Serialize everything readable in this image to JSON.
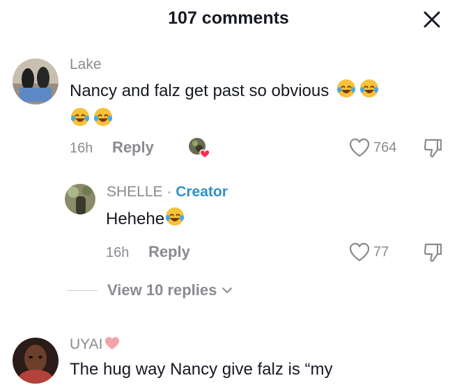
{
  "header": {
    "title": "107 comments"
  },
  "comments": [
    {
      "username": "Lake",
      "text_line1": "Nancy and falz get past so obvious",
      "time": "16h",
      "reply_label": "Reply",
      "likes": "764"
    },
    {
      "username": "SHELLE",
      "separator": " · ",
      "badge": "Creator",
      "text": "Hehehe",
      "time": "16h",
      "reply_label": "Reply",
      "likes": "77"
    },
    {
      "username": "UYAI",
      "text_line1": "The hug way Nancy give falz is “my"
    }
  ],
  "view_replies": {
    "label": "View 10 replies"
  },
  "colors": {
    "text": "#161823",
    "muted": "#8a8b91",
    "creator_accent": "#2f91c9",
    "heart_red": "#fe2c55"
  }
}
